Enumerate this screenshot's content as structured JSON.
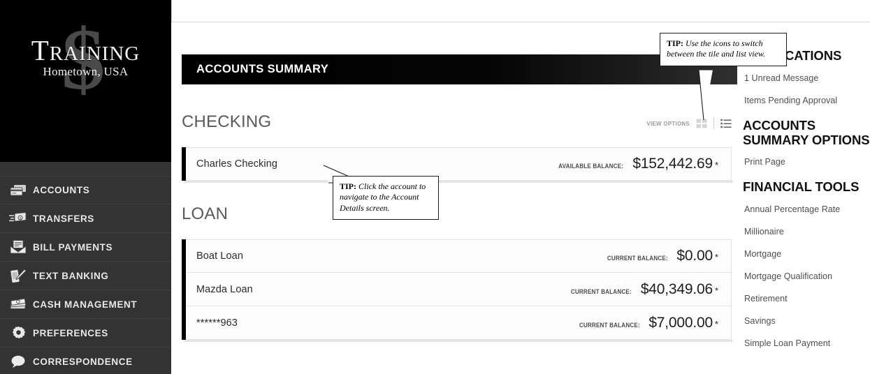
{
  "brand": {
    "name": "Training",
    "tagline": "Hometown, USA",
    "dollar_glyph": "$"
  },
  "sidebar": {
    "items": [
      {
        "label": "ACCOUNTS",
        "icon": "cards-icon"
      },
      {
        "label": "TRANSFERS",
        "icon": "transfer-icon"
      },
      {
        "label": "BILL PAYMENTS",
        "icon": "bill-envelope-icon"
      },
      {
        "label": "TEXT BANKING",
        "icon": "phone-pen-icon"
      },
      {
        "label": "CASH MANAGEMENT",
        "icon": "cash-stack-icon"
      },
      {
        "label": "PREFERENCES",
        "icon": "gear-icon"
      },
      {
        "label": "CORRESPONDENCE",
        "icon": "speech-bubble-icon"
      }
    ]
  },
  "main": {
    "page_title": "ACCOUNTS SUMMARY",
    "view_options_label": "VIEW OPTIONS",
    "view_tile_icon": "grid-tile-icon",
    "view_list_icon": "list-view-icon",
    "sections": [
      {
        "title": "CHECKING",
        "accounts": [
          {
            "name": "Charles Checking",
            "balance_label": "AVAILABLE BALANCE:",
            "balance": "$152,442.69",
            "footnote": "*"
          }
        ]
      },
      {
        "title": "LOAN",
        "accounts": [
          {
            "name": "Boat Loan",
            "balance_label": "CURRENT BALANCE:",
            "balance": "$0.00",
            "footnote": "*"
          },
          {
            "name": "Mazda Loan",
            "balance_label": "CURRENT BALANCE:",
            "balance": "$40,349.06",
            "footnote": "*"
          },
          {
            "name": "******963",
            "balance_label": "CURRENT BALANCE:",
            "balance": "$7,000.00",
            "footnote": "*"
          }
        ]
      }
    ]
  },
  "right_panel": {
    "notifications": {
      "heading": "NOTIFICATIONS",
      "items": [
        "1 Unread Message",
        "Items Pending Approval"
      ]
    },
    "accounts_summary_options": {
      "heading": "ACCOUNTS SUMMARY OPTIONS",
      "items": [
        "Print Page"
      ]
    },
    "financial_tools": {
      "heading": "FINANCIAL TOOLS",
      "items": [
        "Annual Percentage Rate",
        "Millionaire",
        "Mortgage",
        "Mortgage Qualification",
        "Retirement",
        "Savings",
        "Simple Loan Payment"
      ]
    }
  },
  "tips": [
    {
      "lead": "TIP:",
      "text": "Use the icons to switch between the tile and list view."
    },
    {
      "lead": "TIP:",
      "text": "Click the account to navigate to the Account Details screen."
    }
  ]
}
